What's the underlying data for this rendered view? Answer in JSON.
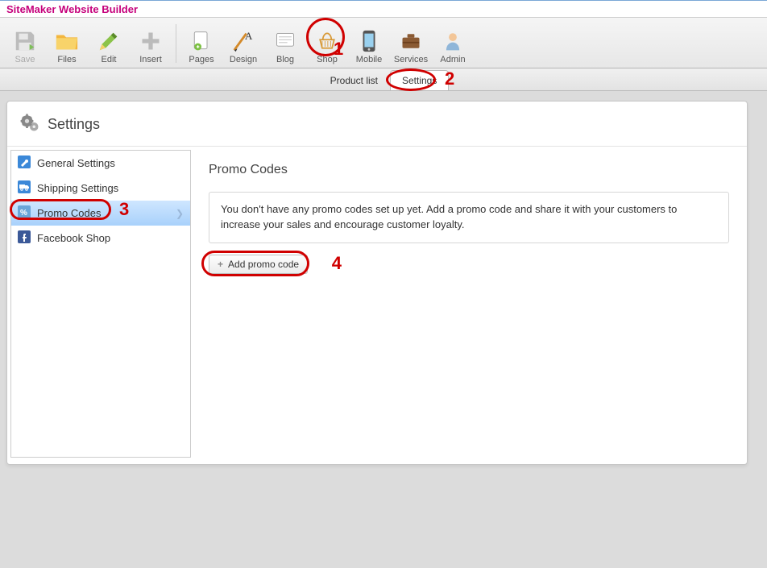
{
  "app": {
    "title": "SiteMaker Website Builder"
  },
  "toolbar": {
    "save": "Save",
    "files": "Files",
    "edit": "Edit",
    "insert": "Insert",
    "pages": "Pages",
    "design": "Design",
    "blog": "Blog",
    "shop": "Shop",
    "mobile": "Mobile",
    "services": "Services",
    "admin": "Admin"
  },
  "subtabs": {
    "productlist": "Product list",
    "settings": "Settings"
  },
  "panel": {
    "title": "Settings"
  },
  "sidebar": {
    "items": [
      {
        "label": "General Settings"
      },
      {
        "label": "Shipping Settings"
      },
      {
        "label": "Promo Codes"
      },
      {
        "label": "Facebook Shop"
      }
    ]
  },
  "content": {
    "heading": "Promo Codes",
    "message": "You don't have any promo codes set up yet. Add a promo code and share it with your customers to increase your sales and encourage customer loyalty.",
    "add_button": "Add promo code"
  },
  "annotations": {
    "n1": "1",
    "n2": "2",
    "n3": "3",
    "n4": "4"
  }
}
